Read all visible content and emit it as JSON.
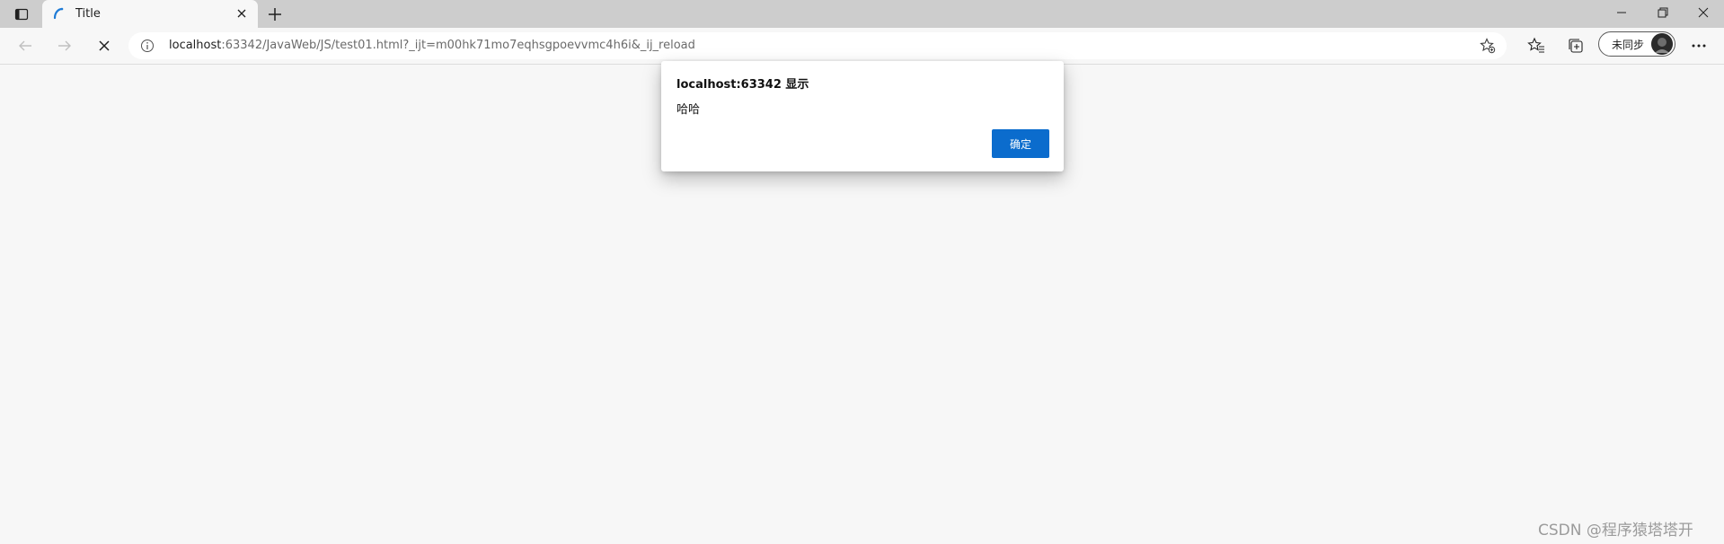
{
  "tab": {
    "title": "Title"
  },
  "address_bar": {
    "host": "localhost",
    "rest": ":63342/JavaWeb/JS/test01.html?_ijt=m00hk71mo7eqhsgpoevvmc4h6i&_ij_reload"
  },
  "profile": {
    "label": "未同步"
  },
  "dialog": {
    "title": "localhost:63342 显示",
    "message": "哈哈",
    "ok_label": "确定"
  },
  "watermark": "CSDN @程序猿塔塔开",
  "colors": {
    "tabstrip": "#cdcdcd",
    "page_bg": "#f7f7f7",
    "ok_button": "#0b6ccd"
  },
  "icons": {
    "tab_actions": "tab-actions-icon",
    "favicon": "intellij-favicon",
    "close": "close-icon",
    "new_tab": "plus-icon",
    "minimize": "minimize-icon",
    "restore": "restore-icon",
    "window_close": "close-icon",
    "back": "back-arrow-icon",
    "forward": "forward-arrow-icon",
    "stop": "stop-loading-icon",
    "info": "info-icon",
    "add_favorite": "add-favorite-icon",
    "favorites": "favorites-icon",
    "collections": "collections-icon",
    "more": "more-icon"
  }
}
